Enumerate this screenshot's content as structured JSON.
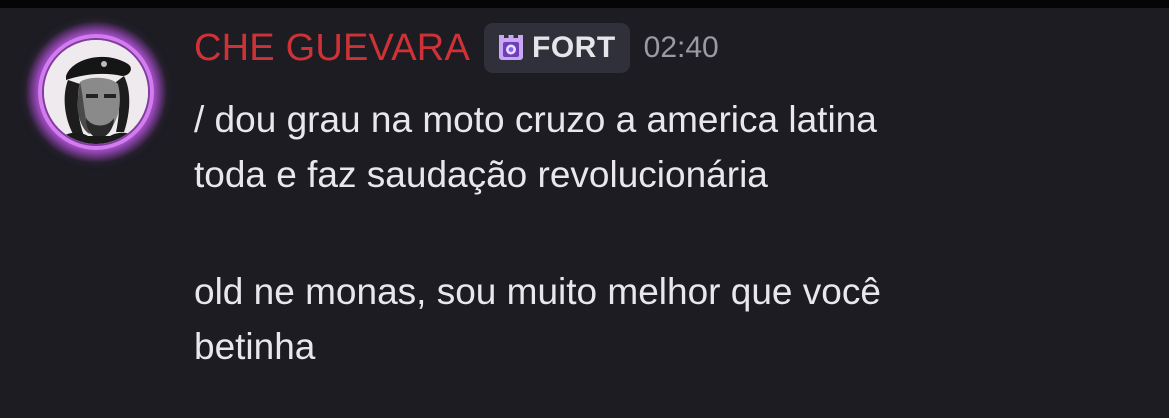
{
  "message": {
    "author": {
      "name": "CHE GUEVARA",
      "name_color": "#cf3236",
      "avatar": "che-guevara-portrait",
      "avatar_decoration_color": "#d27cf0"
    },
    "tag": {
      "icon": "fort-tower-icon",
      "label": "FORT"
    },
    "timestamp": "02:40",
    "paragraph_1": [
      "/ dou grau na moto cruzo a america latina",
      "toda e faz saudação revolucionária"
    ],
    "paragraph_2": [
      "old ne monas, sou muito melhor que você",
      "betinha"
    ]
  },
  "colors": {
    "background": "#1c1c22",
    "text": "#e8e8ec",
    "timestamp": "#9a9aa3",
    "tag_background": "#2f3039"
  }
}
